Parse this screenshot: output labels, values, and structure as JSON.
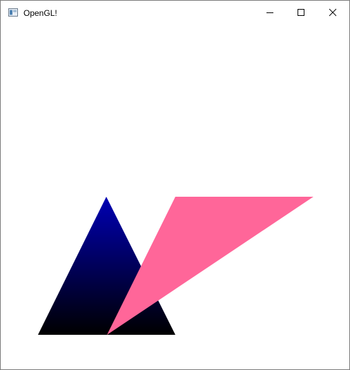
{
  "window": {
    "title": "OpenGL!",
    "icon": "window-app-icon",
    "controls": [
      {
        "name": "minimize",
        "icon": "minimize-icon"
      },
      {
        "name": "maximize",
        "icon": "maximize-icon"
      },
      {
        "name": "close",
        "icon": "close-icon"
      }
    ]
  },
  "colors": {
    "background": "#ffffff",
    "triangle_gradient_top": "#0000b4",
    "triangle_gradient_bottom": "#000000",
    "pink_triangle": "#ff6699"
  }
}
